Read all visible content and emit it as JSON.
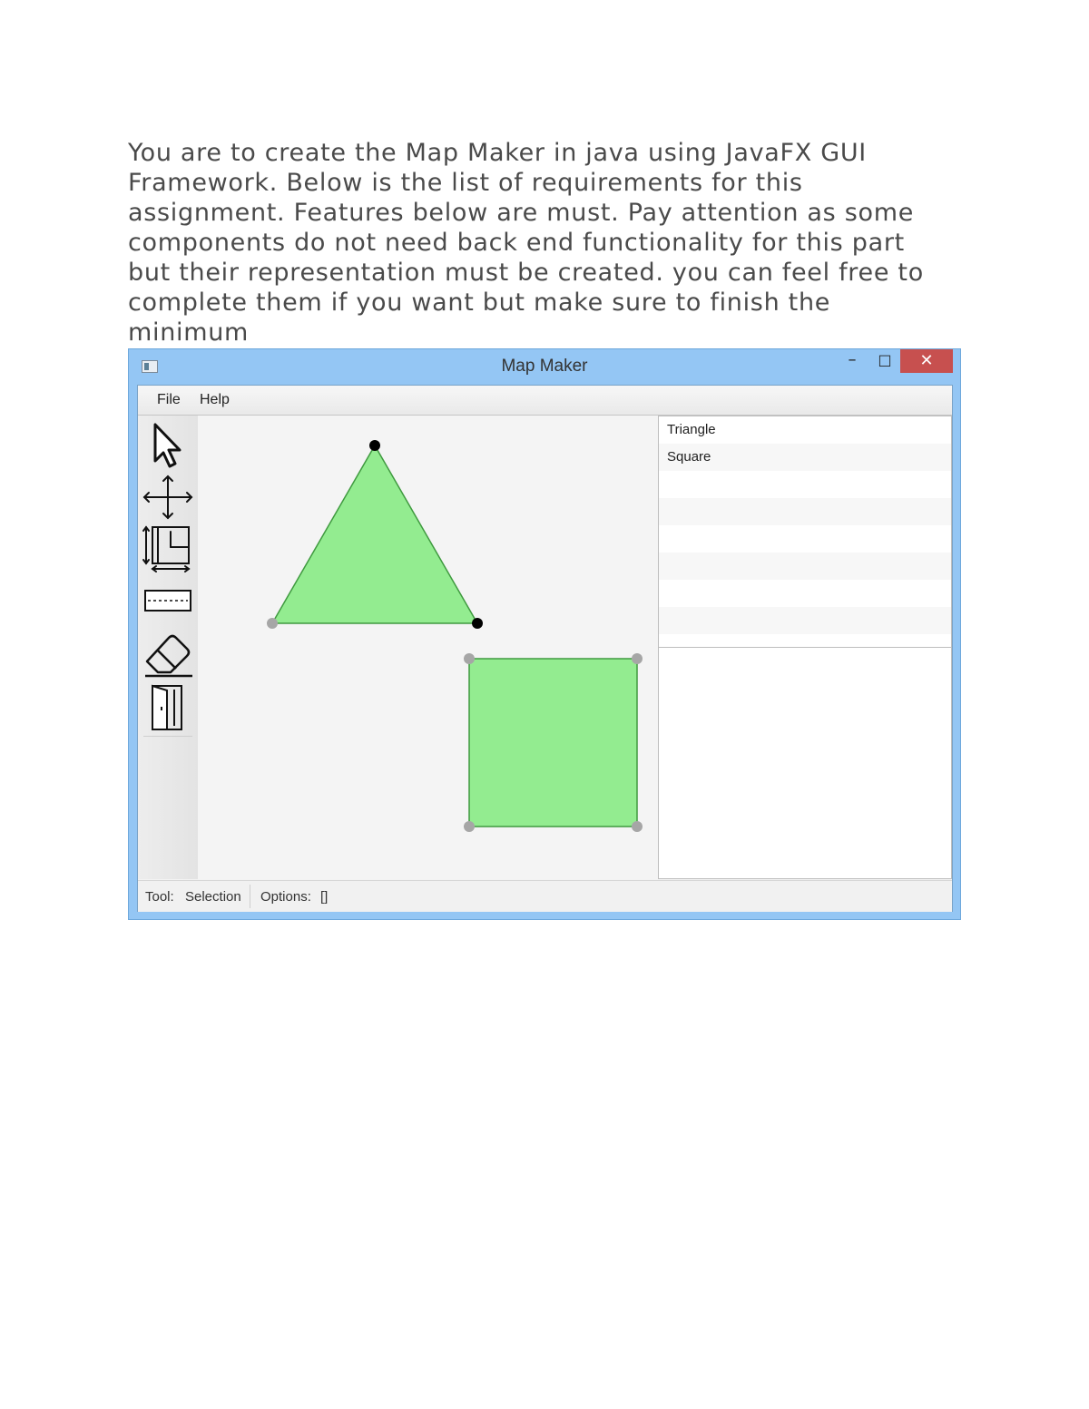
{
  "intro_text": "You are to create the Map Maker in java using JavaFX GUI Framework. Below is the list of requirements for this assignment. Features below are must. Pay attention as some components do not need back end functionality for this part but their representation must be created. you can feel free to complete them if you want but make sure to finish the minimum",
  "window": {
    "title": "Map Maker",
    "buttons": {
      "minimize": "–",
      "maximize": "□",
      "close": "✕"
    }
  },
  "menu": {
    "file": "File",
    "help": "Help"
  },
  "toolbar": {
    "tools": [
      "selection-pointer-icon",
      "move-arrows-icon",
      "room-resize-icon",
      "path-dashed-icon",
      "eraser-icon",
      "door-icon"
    ]
  },
  "shapes_list": {
    "items": [
      "Triangle",
      "Square"
    ]
  },
  "status": {
    "tool_label": "Tool:",
    "tool_value": "Selection",
    "options_label": "Options:",
    "options_value": "[]"
  },
  "colors": {
    "shape_fill": "#93ec90",
    "shape_stroke": "#3f9a3f",
    "selected_handle": "#000000",
    "unselected_handle": "#a6a6a6",
    "titlebar": "#94c6f4",
    "close_button": "#c7504f"
  }
}
